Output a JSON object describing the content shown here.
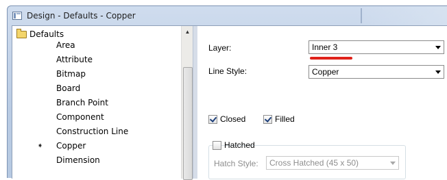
{
  "window": {
    "title": "Design - Defaults - Copper"
  },
  "tree": {
    "root_label": "Defaults",
    "items": [
      {
        "label": "Area"
      },
      {
        "label": "Attribute"
      },
      {
        "label": "Bitmap"
      },
      {
        "label": "Board"
      },
      {
        "label": "Branch Point"
      },
      {
        "label": "Component"
      },
      {
        "label": "Construction Line"
      },
      {
        "label": "Copper",
        "selected": true
      },
      {
        "label": "Dimension"
      }
    ]
  },
  "props": {
    "layer_label": "Layer:",
    "layer_value": "Inner 3",
    "line_style_label": "Line Style:",
    "line_style_value": "Copper",
    "closed_label": "Closed",
    "closed_checked": true,
    "filled_label": "Filled",
    "filled_checked": true,
    "hatched_label": "Hatched",
    "hatched_checked": false,
    "hatch_style_label": "Hatch Style:",
    "hatch_style_value": "Cross Hatched (45 x 50)"
  },
  "colors": {
    "annotation_underline": "#e0221a"
  }
}
